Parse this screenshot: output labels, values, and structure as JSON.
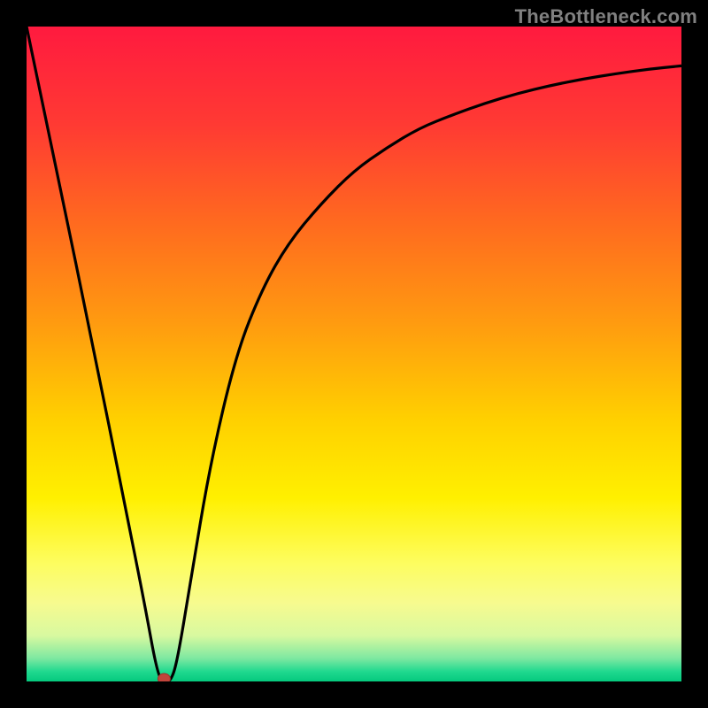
{
  "watermark": "TheBottleneck.com",
  "colors": {
    "frame": "#000000",
    "curve": "#000000",
    "dot_fill": "#c1443b",
    "dot_stroke": "#9a342d",
    "gradient_stops": [
      {
        "offset": 0.0,
        "color": "#ff1a3f"
      },
      {
        "offset": 0.15,
        "color": "#ff3a33"
      },
      {
        "offset": 0.3,
        "color": "#ff6a1f"
      },
      {
        "offset": 0.45,
        "color": "#ff9a10"
      },
      {
        "offset": 0.6,
        "color": "#ffd000"
      },
      {
        "offset": 0.72,
        "color": "#fff000"
      },
      {
        "offset": 0.82,
        "color": "#fdfd60"
      },
      {
        "offset": 0.88,
        "color": "#f7fb8f"
      },
      {
        "offset": 0.93,
        "color": "#d8f9a0"
      },
      {
        "offset": 0.965,
        "color": "#7de8a1"
      },
      {
        "offset": 0.985,
        "color": "#1fd98f"
      },
      {
        "offset": 1.0,
        "color": "#05c97e"
      }
    ]
  },
  "chart_data": {
    "type": "line",
    "title": "",
    "xlabel": "",
    "ylabel": "",
    "xlim": [
      0,
      100
    ],
    "ylim": [
      0,
      100
    ],
    "grid": false,
    "series": [
      {
        "name": "bottleneck-curve",
        "x": [
          0,
          5,
          10,
          15,
          18,
          20,
          21,
          22,
          23,
          25,
          28,
          32,
          36,
          40,
          45,
          50,
          55,
          60,
          65,
          70,
          75,
          80,
          85,
          90,
          95,
          100
        ],
        "y": [
          100,
          76,
          52,
          27,
          12,
          1,
          0,
          0,
          3,
          15,
          33,
          50,
          60,
          67,
          73,
          78,
          81.5,
          84.5,
          86.5,
          88.3,
          89.8,
          91,
          92,
          92.8,
          93.5,
          94
        ]
      }
    ],
    "marker": {
      "x": 21,
      "y": 0,
      "name": "minimum-point"
    }
  }
}
